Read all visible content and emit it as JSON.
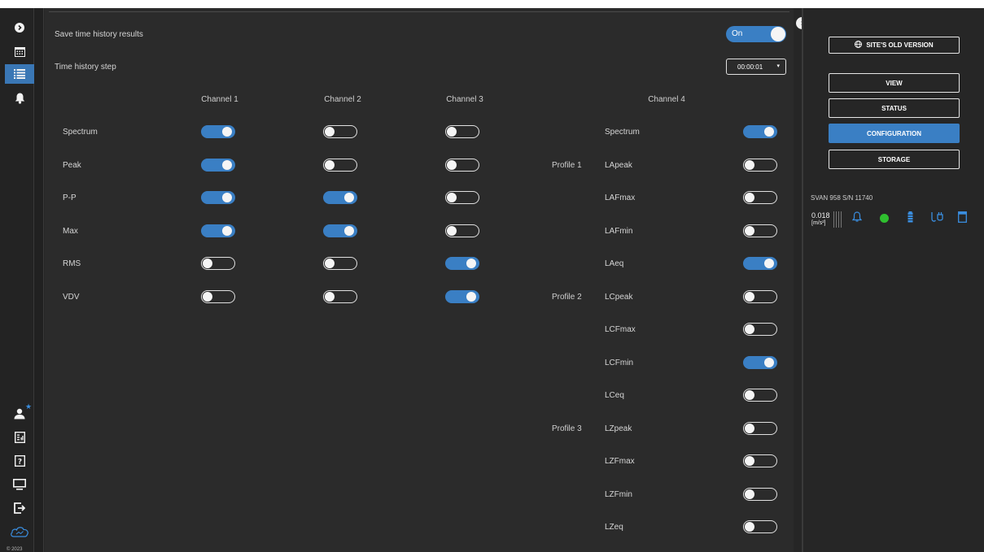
{
  "sidebar": {
    "items": [
      {
        "icon": "chevron-right-circle-icon"
      },
      {
        "icon": "calendar-icon"
      },
      {
        "icon": "list-icon",
        "active": true
      },
      {
        "icon": "bell-icon"
      },
      {
        "icon": "user-star-icon"
      },
      {
        "icon": "report-icon"
      },
      {
        "icon": "help-icon"
      },
      {
        "icon": "monitor-icon"
      },
      {
        "icon": "logout-icon"
      },
      {
        "icon": "cloud-icon"
      }
    ],
    "copyright": "© 2023"
  },
  "settings": {
    "save_label": "Save time history results",
    "save_value": "On",
    "step_label": "Time history step",
    "step_value": "00:00:01"
  },
  "columns": [
    "Channel 1",
    "Channel 2",
    "Channel 3",
    "Channel 4"
  ],
  "rows": [
    {
      "label": "Spectrum",
      "ch1": true,
      "ch2": false,
      "ch3": false
    },
    {
      "label": "Peak",
      "ch1": true,
      "ch2": false,
      "ch3": false
    },
    {
      "label": "P-P",
      "ch1": true,
      "ch2": true,
      "ch3": false
    },
    {
      "label": "Max",
      "ch1": true,
      "ch2": true,
      "ch3": false
    },
    {
      "label": "RMS",
      "ch1": false,
      "ch2": false,
      "ch3": true
    },
    {
      "label": "VDV",
      "ch1": false,
      "ch2": false,
      "ch3": true
    }
  ],
  "channel4": {
    "items": [
      {
        "label": "Spectrum",
        "on": true
      },
      {
        "label": "LApeak",
        "on": false
      },
      {
        "label": "LAFmax",
        "on": false
      },
      {
        "label": "LAFmin",
        "on": false
      },
      {
        "label": "LAeq",
        "on": true
      },
      {
        "label": "LCpeak",
        "on": false
      },
      {
        "label": "LCFmax",
        "on": false
      },
      {
        "label": "LCFmin",
        "on": true
      },
      {
        "label": "LCeq",
        "on": false
      },
      {
        "label": "LZpeak",
        "on": false
      },
      {
        "label": "LZFmax",
        "on": false
      },
      {
        "label": "LZFmin",
        "on": false
      },
      {
        "label": "LZeq",
        "on": false
      }
    ],
    "profiles": [
      {
        "label": "Profile 1",
        "row": 1
      },
      {
        "label": "Profile 2",
        "row": 5
      },
      {
        "label": "Profile 3",
        "row": 9
      }
    ]
  },
  "right_panel": {
    "old_version_label": "SITE'S OLD VERSION",
    "nav": [
      {
        "label": "VIEW",
        "active": false
      },
      {
        "label": "STATUS",
        "active": false
      },
      {
        "label": "CONFIGURATION",
        "active": true
      },
      {
        "label": "STORAGE",
        "active": false
      }
    ],
    "device_name": "SVAN 958 S/N 11740",
    "reading_value": "0.018",
    "reading_unit": "[m/s²]",
    "status_color": "#2fbf2f",
    "accent_color": "#3a7fc4"
  }
}
